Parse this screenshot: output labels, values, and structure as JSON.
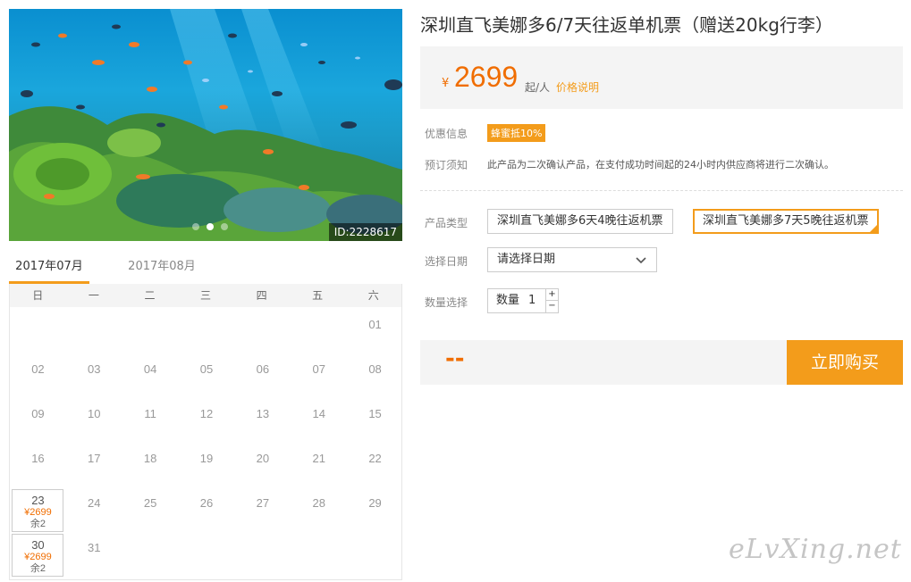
{
  "hero": {
    "id_label": "ID:2228617",
    "dots": [
      false,
      true,
      false
    ]
  },
  "calendar": {
    "months": [
      {
        "label": "2017年07月",
        "active": true
      },
      {
        "label": "2017年08月",
        "active": false
      }
    ],
    "weekdays": [
      "日",
      "一",
      "二",
      "三",
      "四",
      "五",
      "六"
    ],
    "days": [
      {
        "d": "01"
      },
      {
        "d": "02"
      },
      {
        "d": "03"
      },
      {
        "d": "04"
      },
      {
        "d": "05"
      },
      {
        "d": "06"
      },
      {
        "d": "07"
      },
      {
        "d": "08"
      },
      {
        "d": "09"
      },
      {
        "d": "10"
      },
      {
        "d": "11"
      },
      {
        "d": "12"
      },
      {
        "d": "13"
      },
      {
        "d": "14"
      },
      {
        "d": "15"
      },
      {
        "d": "16"
      },
      {
        "d": "17"
      },
      {
        "d": "18"
      },
      {
        "d": "19"
      },
      {
        "d": "20"
      },
      {
        "d": "21"
      },
      {
        "d": "22"
      },
      {
        "d": "23",
        "price": "¥2699",
        "left": "余2"
      },
      {
        "d": "24"
      },
      {
        "d": "25"
      },
      {
        "d": "26"
      },
      {
        "d": "27"
      },
      {
        "d": "28"
      },
      {
        "d": "29"
      },
      {
        "d": "30",
        "price": "¥2699",
        "left": "余2"
      },
      {
        "d": "31"
      }
    ]
  },
  "product": {
    "title": "深圳直飞美娜多6/7天往返单机票（赠送20kg行李）",
    "price_currency": "¥",
    "price_amount": "2699",
    "price_unit": "起/人",
    "price_explain": "价格说明"
  },
  "info": {
    "discount_label": "优惠信息",
    "discount_badge": "蜂蜜抵10%",
    "notice_label": "预订须知",
    "notice_text": "此产品为二次确认产品，在支付成功时间起的24小时内供应商将进行二次确认。"
  },
  "options": {
    "type_label": "产品类型",
    "types": [
      {
        "label": "深圳直飞美娜多6天4晚往返机票",
        "selected": false
      },
      {
        "label": "深圳直飞美娜多7天5晚往返机票",
        "selected": true
      }
    ],
    "date_label": "选择日期",
    "date_placeholder": "请选择日期",
    "qty_label": "数量选择",
    "qty_inner_label": "数量",
    "qty_value": "1",
    "qty_plus": "+",
    "qty_minus": "−"
  },
  "buy": {
    "total": "--",
    "button": "立即购买"
  },
  "watermark": "eLvXing.net",
  "colors": {
    "accent": "#f39c1b",
    "price": "#f06d00"
  }
}
